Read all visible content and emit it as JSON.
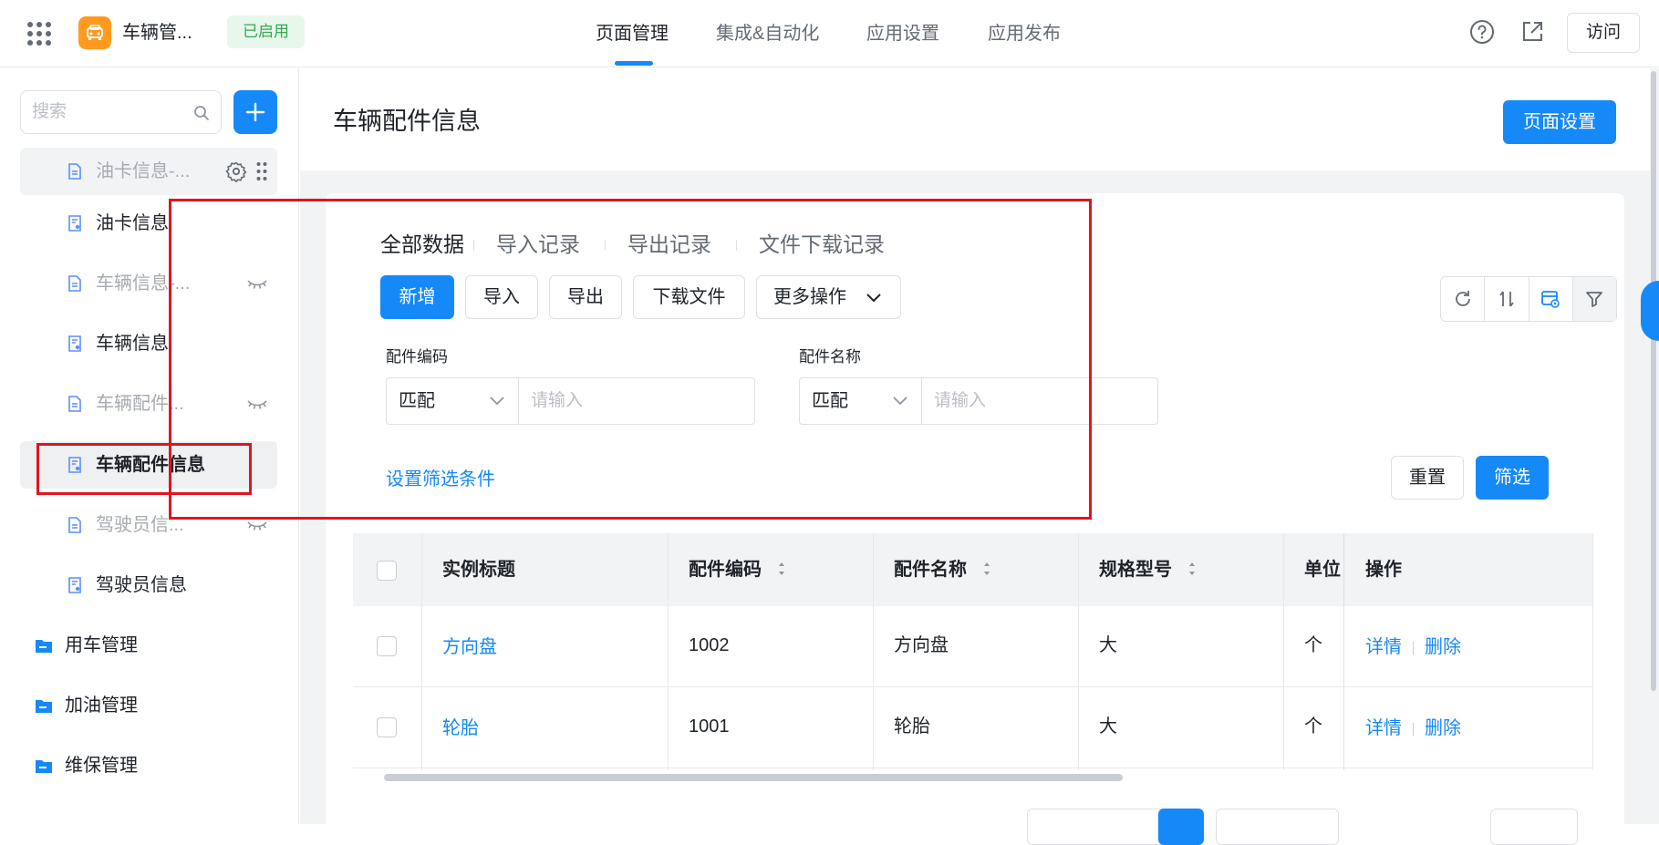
{
  "app": {
    "name": "车辆管...",
    "status": "已启用",
    "visit_label": "访问",
    "accent": "#1689f9",
    "logo_color": "#ff9a1f"
  },
  "top_tabs": [
    {
      "label": "页面管理",
      "active": true
    },
    {
      "label": "集成&自动化",
      "active": false
    },
    {
      "label": "应用设置",
      "active": false
    },
    {
      "label": "应用发布",
      "active": false
    }
  ],
  "sidebar": {
    "search_placeholder": "搜索",
    "items": [
      {
        "label": "油卡信息-...",
        "type": "page",
        "hidden": false,
        "hover": true
      },
      {
        "label": "油卡信息",
        "type": "form",
        "hidden": false
      },
      {
        "label": "车辆信息-...",
        "type": "page",
        "hidden": true
      },
      {
        "label": "车辆信息",
        "type": "form",
        "hidden": false
      },
      {
        "label": "车辆配件...",
        "type": "page",
        "hidden": true
      },
      {
        "label": "车辆配件信息",
        "type": "form",
        "hidden": false,
        "active": true
      },
      {
        "label": "驾驶员信...",
        "type": "page",
        "hidden": true
      },
      {
        "label": "驾驶员信息",
        "type": "form",
        "hidden": false
      }
    ],
    "folders": [
      {
        "label": "用车管理"
      },
      {
        "label": "加油管理"
      },
      {
        "label": "维保管理"
      }
    ]
  },
  "page": {
    "title": "车辆配件信息",
    "settings_label": "页面设置"
  },
  "data_tabs": [
    {
      "label": "全部数据",
      "active": true
    },
    {
      "label": "导入记录",
      "active": false
    },
    {
      "label": "导出记录",
      "active": false
    },
    {
      "label": "文件下载记录",
      "active": false
    }
  ],
  "toolbar": {
    "add": "新增",
    "import": "导入",
    "export": "导出",
    "download": "下载文件",
    "more": "更多操作"
  },
  "filters": [
    {
      "label": "配件编码",
      "match": "匹配",
      "placeholder": "请输入"
    },
    {
      "label": "配件名称",
      "match": "匹配",
      "placeholder": "请输入"
    }
  ],
  "filter_actions": {
    "set_conditions": "设置筛选条件",
    "reset": "重置",
    "apply": "筛选"
  },
  "table": {
    "columns": [
      "实例标题",
      "配件编码",
      "配件名称",
      "规格型号",
      "单位",
      "操作"
    ],
    "rows": [
      {
        "title": "方向盘",
        "code": "1002",
        "name": "方向盘",
        "spec": "大",
        "unit": "个",
        "detail": "详情",
        "delete": "删除"
      },
      {
        "title": "轮胎",
        "code": "1001",
        "name": "轮胎",
        "spec": "大",
        "unit": "个",
        "detail": "详情",
        "delete": "删除"
      }
    ]
  }
}
